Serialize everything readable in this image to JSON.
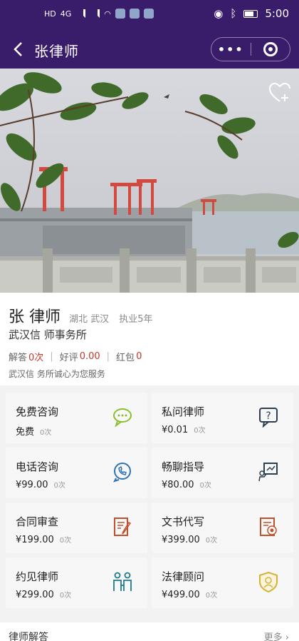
{
  "status_bar": {
    "time": "5:00",
    "network_left": "HD",
    "network_left2": "HD",
    "net_type": "4G"
  },
  "nav": {
    "title": "张律师",
    "more_label": "•••"
  },
  "profile": {
    "name": "张 律师",
    "location": "湖北 武汉",
    "experience": "执业5年",
    "firm": "武汉信 师事务所",
    "stats": {
      "answers_label": "解答",
      "answers_value": "0次",
      "rating_label": "好评",
      "rating_value": "0.00",
      "red_packet_label": "红包",
      "red_packet_value": "0"
    },
    "slogan": "武汉信 务所诚心为您服务"
  },
  "services": [
    {
      "title": "免费咨询",
      "price": "免费",
      "count": "0次",
      "icon": "chat-bubble-icon",
      "color": "#8bbf2f"
    },
    {
      "title": "私问律师",
      "price": "¥0.01",
      "count": "0次",
      "icon": "question-bubble-icon",
      "color": "#2d3e50"
    },
    {
      "title": "电话咨询",
      "price": "¥99.00",
      "count": "0次",
      "icon": "phone-bubble-icon",
      "color": "#2e74b5"
    },
    {
      "title": "畅聊指导",
      "price": "¥80.00",
      "count": "0次",
      "icon": "guidance-board-icon",
      "color": "#2d3e50"
    },
    {
      "title": "合同审查",
      "price": "¥199.00",
      "count": "0次",
      "icon": "contract-pen-icon",
      "color": "#c0522b"
    },
    {
      "title": "文书代写",
      "price": "¥399.00",
      "count": "0次",
      "icon": "document-seal-icon",
      "color": "#c0522b"
    },
    {
      "title": "约见律师",
      "price": "¥299.00",
      "count": "0次",
      "icon": "meet-people-icon",
      "color": "#1d7a8c"
    },
    {
      "title": "法律顾问",
      "price": "¥499.00",
      "count": "0次",
      "icon": "shield-badge-icon",
      "color": "#d4b23a"
    }
  ],
  "answers_section": {
    "title": "律师解答",
    "more_label": "更多 ›"
  },
  "colors": {
    "brand": "#3a1d6a",
    "accent_red": "#c0392b"
  }
}
